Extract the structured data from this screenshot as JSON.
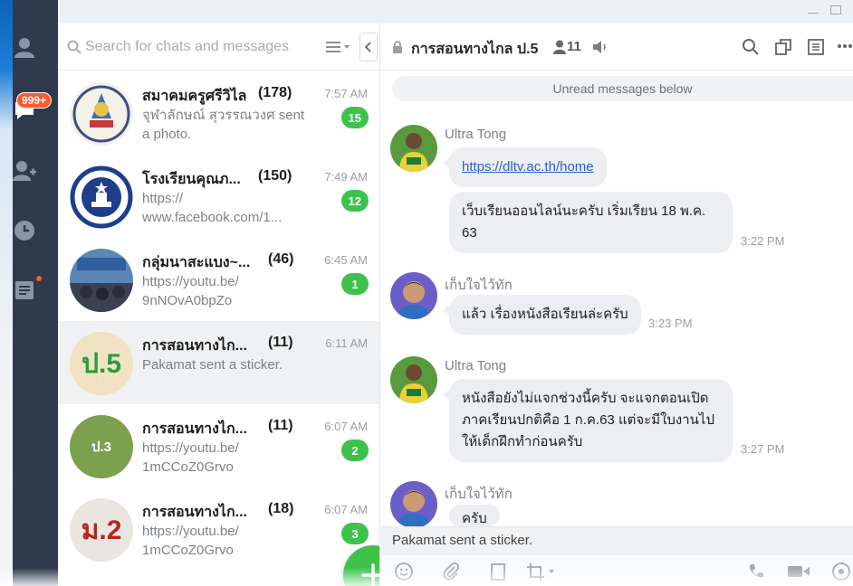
{
  "window": {
    "minimize": "minimize",
    "maximize": "maximize"
  },
  "rail": {
    "unread_badge": "999+",
    "icons": [
      "person-icon",
      "chat-bubble-icon",
      "add-friend-icon",
      "clock-icon",
      "timeline-icon"
    ]
  },
  "search": {
    "placeholder": "Search for chats and messages"
  },
  "chats": [
    {
      "name": "สมาคมครูศรีวิไล",
      "count": "(178)",
      "time": "7:57 AM",
      "preview": "จุฬาลักษณ์ สุวรรณวงศ sent a photo.",
      "badge": "15"
    },
    {
      "name": "โรงเรียนคุณภ...",
      "count": "(150)",
      "time": "7:49 AM",
      "preview": "https:// www.facebook.com/1...",
      "badge": "12"
    },
    {
      "name": "กลุ่มนาสะแบง~...",
      "count": "(46)",
      "time": "6:45 AM",
      "preview": "https://youtu.be/ 9nNOvA0bpZo",
      "badge": "1"
    },
    {
      "name": "การสอนทางไก...",
      "count": "(11)",
      "time": "6:11 AM",
      "preview": "Pakamat sent a sticker.",
      "badge": "",
      "avatar_text": "ป.5"
    },
    {
      "name": "การสอนทางไก...",
      "count": "(11)",
      "time": "6:07 AM",
      "preview": "https://youtu.be/ 1mCCoZ0Grvo",
      "badge": "2",
      "avatar_text": "ป.3"
    },
    {
      "name": "การสอนทางไก...",
      "count": "(18)",
      "time": "6:07 AM",
      "preview": "https://youtu.be/ 1mCCoZ0Grvo",
      "badge": "3",
      "avatar_text": "ม.2"
    }
  ],
  "room": {
    "title": "การสอนทางไกล ป.5",
    "members": "11"
  },
  "unread_label": "Unread messages below",
  "messages": [
    {
      "sender": "Ultra Tong",
      "link": "https://dltv.ac.th/home"
    },
    {
      "text": "เว็บเรียนออนไลน์นะครับ เริ่มเรียน 18 พ.ค. 63",
      "time": "3:22 PM"
    },
    {
      "sender": "เก็บใจไว้ทัก",
      "text": "แล้ว เรื่องหนังสือเรียนล่ะครับ",
      "time": "3:23 PM"
    },
    {
      "sender": "Ultra Tong",
      "text": "หนังสือยังไม่แจกช่วงนี้ครับ จะแจกตอนเปิดภาคเรียนปกติคือ 1 ก.ค.63 แต่จะมีใบงานไปให้เด็กฝึกทำก่อนครับ",
      "time": "3:27 PM"
    },
    {
      "sender": "เก็บใจไว้ทัก",
      "text": "ครับ"
    }
  ],
  "preview_bar": "Pakamat sent a sticker.",
  "colors": {
    "accent_green": "#3dc34c",
    "rail": "#2f3a4d",
    "badge_orange": "#ff5a2b",
    "link_blue": "#2d63c8"
  }
}
